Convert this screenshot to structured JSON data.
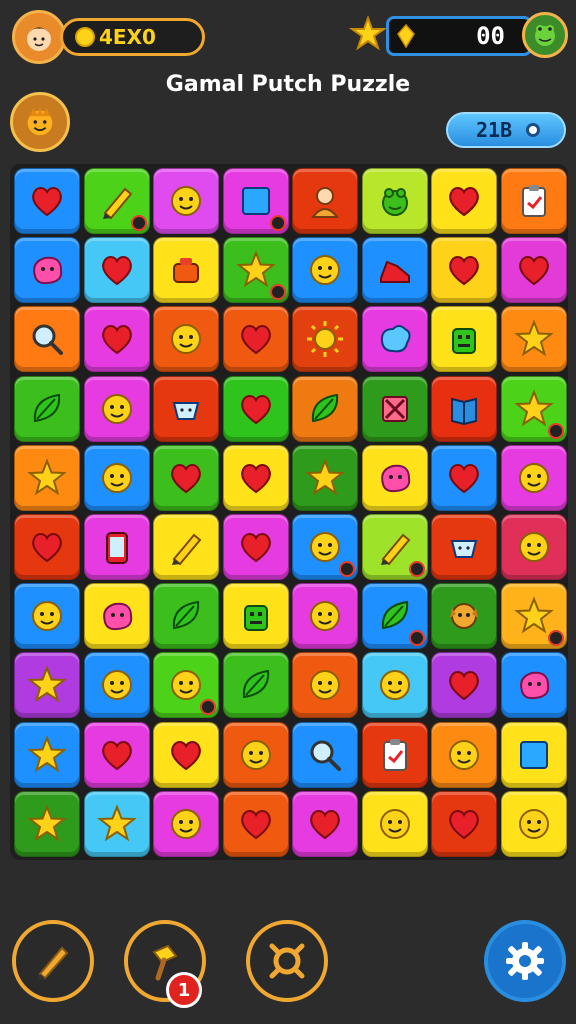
{
  "hud": {
    "coins_text": "4EX0",
    "gems_text": "00",
    "level_text": "21B"
  },
  "title": "Gamal Putch Puzzle",
  "board": {
    "rows": [
      [
        [
          "#1e90ff",
          "heart"
        ],
        [
          "#4cd219",
          "pencil"
        ],
        [
          "#e04bf0",
          "face"
        ],
        [
          "#e63be0",
          "square"
        ],
        [
          "#e6380f",
          "person"
        ],
        [
          "#b8e62a",
          "frog"
        ],
        [
          "#ffe21a",
          "heart"
        ],
        [
          "#ff7a12",
          "clipboard"
        ]
      ],
      [
        [
          "#1e90ff",
          "blob"
        ],
        [
          "#45c8f5",
          "heart"
        ],
        [
          "#ffe21a",
          "pot"
        ],
        [
          "#3cbf1c",
          "star"
        ],
        [
          "#1e90ff",
          "face"
        ],
        [
          "#1e90ff",
          "shoe"
        ],
        [
          "#ffd21a",
          "heart"
        ],
        [
          "#e23bd8",
          "heart"
        ]
      ],
      [
        [
          "#ff7a12",
          "magnifier"
        ],
        [
          "#e63be0",
          "heart"
        ],
        [
          "#f05a10",
          "face"
        ],
        [
          "#f05a10",
          "heart"
        ],
        [
          "#e2400e",
          "sun"
        ],
        [
          "#e63be0",
          "splat"
        ],
        [
          "#ffe21a",
          "robot"
        ],
        [
          "#ff8a12",
          "star"
        ]
      ],
      [
        [
          "#3cbf1c",
          "leaf"
        ],
        [
          "#e63be0",
          "face"
        ],
        [
          "#e6380f",
          "cup"
        ],
        [
          "#2ec41c",
          "heart"
        ],
        [
          "#f07a12",
          "leaf"
        ],
        [
          "#2f9b1c",
          "cross"
        ],
        [
          "#e6300f",
          "book"
        ],
        [
          "#4cd219",
          "star"
        ]
      ],
      [
        [
          "#ff8a12",
          "star"
        ],
        [
          "#1e90ff",
          "face"
        ],
        [
          "#3cbf1c",
          "heart"
        ],
        [
          "#ffe21a",
          "heart"
        ],
        [
          "#2f9b1c",
          "star"
        ],
        [
          "#ffe21a",
          "blob"
        ],
        [
          "#1e90ff",
          "heart"
        ],
        [
          "#e63be0",
          "face"
        ]
      ],
      [
        [
          "#e6380f",
          "heart"
        ],
        [
          "#e63be0",
          "phone"
        ],
        [
          "#ffe21a",
          "pencil"
        ],
        [
          "#e63be0",
          "heart"
        ],
        [
          "#1e90ff",
          "face"
        ],
        [
          "#9ee22a",
          "pencil"
        ],
        [
          "#e6380f",
          "cup"
        ],
        [
          "#e0305a",
          "face"
        ]
      ],
      [
        [
          "#1e90ff",
          "face"
        ],
        [
          "#ffe21a",
          "blob"
        ],
        [
          "#3cbf1c",
          "leaf"
        ],
        [
          "#ffe21a",
          "robot"
        ],
        [
          "#e63be0",
          "face"
        ],
        [
          "#1e90ff",
          "leaf"
        ],
        [
          "#2f9b1c",
          "dog"
        ],
        [
          "#ffb21a",
          "star"
        ]
      ],
      [
        [
          "#b03be0",
          "star"
        ],
        [
          "#1e90ff",
          "face"
        ],
        [
          "#4cd219",
          "face"
        ],
        [
          "#3cbf1c",
          "leaf"
        ],
        [
          "#f05a10",
          "face"
        ],
        [
          "#45c8f5",
          "face"
        ],
        [
          "#b03be0",
          "heart"
        ],
        [
          "#1e90ff",
          "blob"
        ]
      ],
      [
        [
          "#1e90ff",
          "star"
        ],
        [
          "#e63be0",
          "heart"
        ],
        [
          "#ffe21a",
          "heart"
        ],
        [
          "#f05a10",
          "face"
        ],
        [
          "#1e90ff",
          "magnifier"
        ],
        [
          "#e6380f",
          "clipboard"
        ],
        [
          "#ff8a12",
          "face"
        ],
        [
          "#ffe21a",
          "square"
        ]
      ],
      [
        [
          "#2f9b1c",
          "star"
        ],
        [
          "#45c8f5",
          "star"
        ],
        [
          "#e63be0",
          "face"
        ],
        [
          "#f05a10",
          "heart"
        ],
        [
          "#e63be0",
          "heart"
        ],
        [
          "#ffe21a",
          "face"
        ],
        [
          "#e6380f",
          "heart"
        ],
        [
          "#ffe21a",
          "face"
        ]
      ]
    ]
  },
  "tools": {
    "booster_count": "1"
  },
  "colors": {
    "board_bg": "#1e1e1e",
    "accent_gold": "#f0a830",
    "accent_blue": "#2a8ee0"
  }
}
